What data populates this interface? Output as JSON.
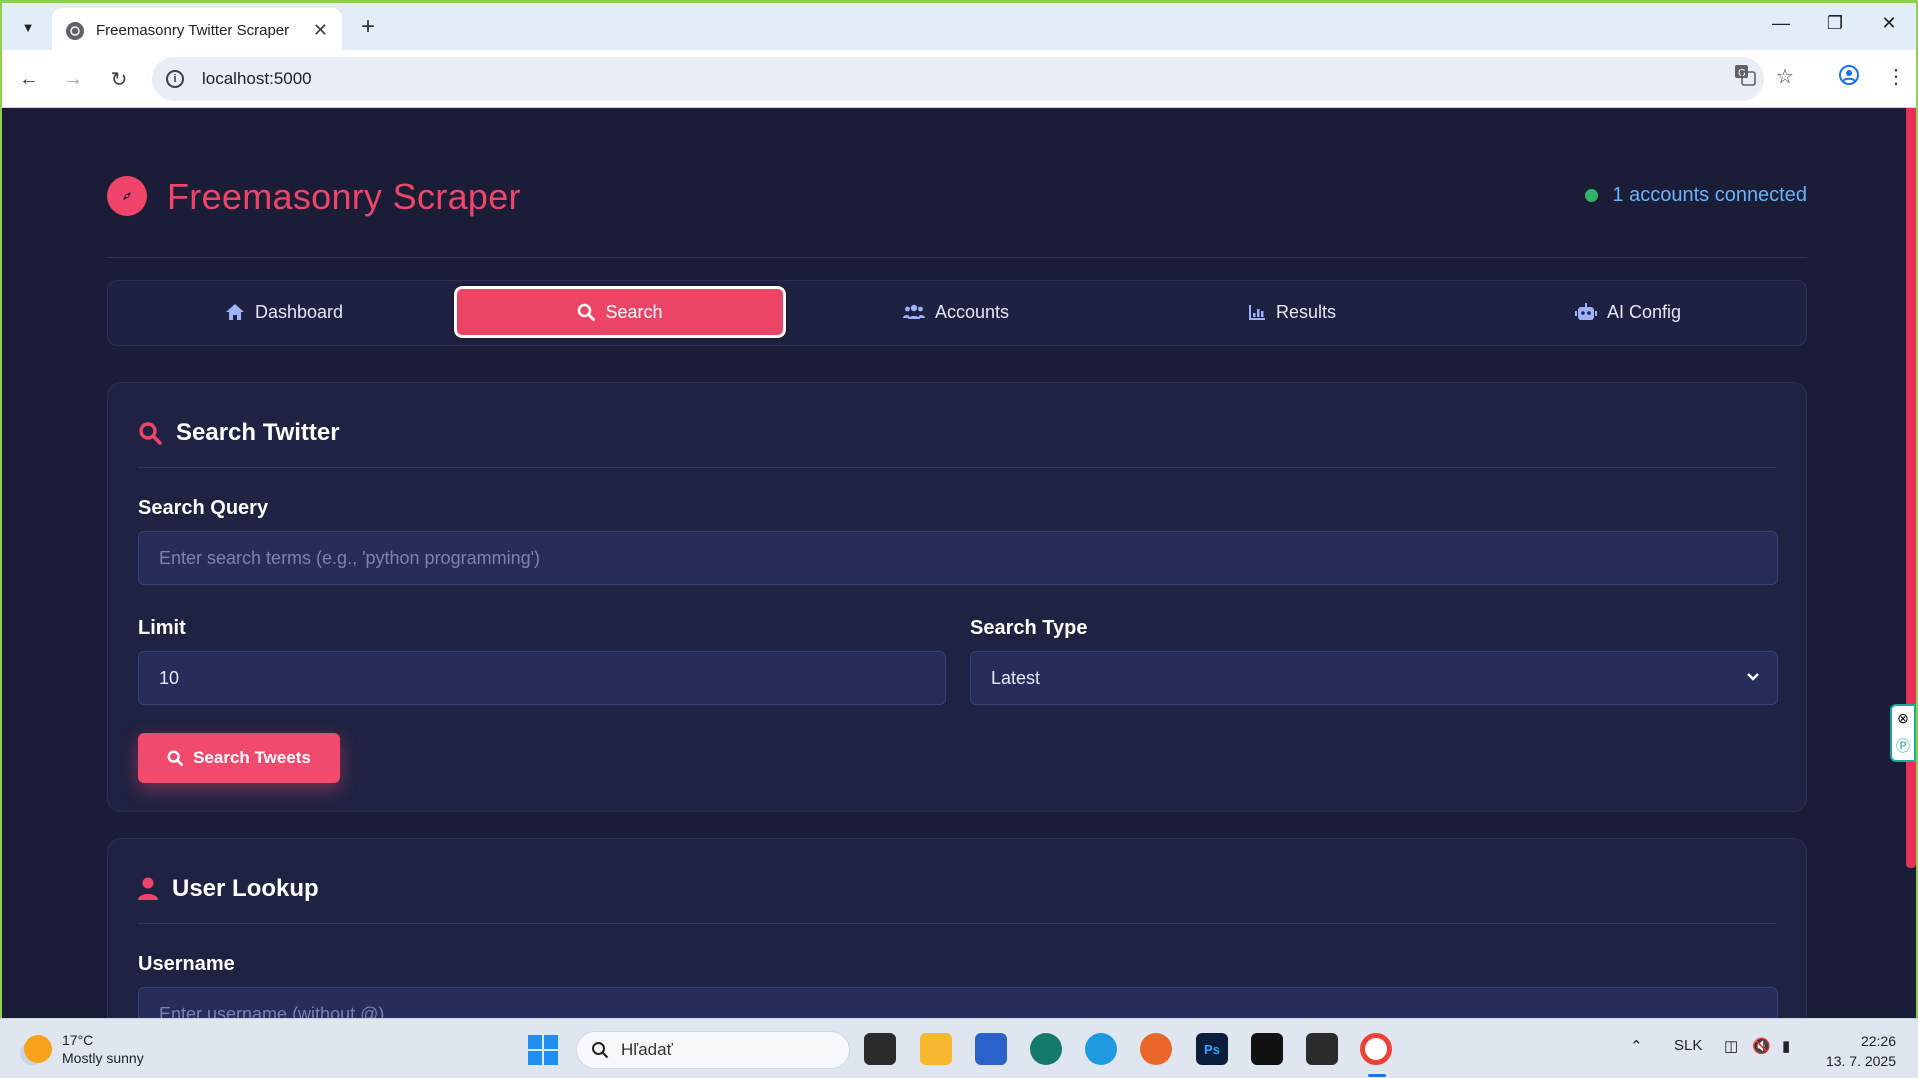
{
  "browser": {
    "tab_title": "Freemasonry Twitter Scraper",
    "url": "localhost:5000"
  },
  "app": {
    "title": "Freemasonry Scraper",
    "status": "1 accounts connected",
    "accent": "#f0446b",
    "status_color": "#2fb467"
  },
  "nav": {
    "tabs": [
      {
        "label": "Dashboard",
        "icon": "home-icon"
      },
      {
        "label": "Search",
        "icon": "search-icon",
        "active": true
      },
      {
        "label": "Accounts",
        "icon": "users-icon"
      },
      {
        "label": "Results",
        "icon": "chart-icon"
      },
      {
        "label": "AI Config",
        "icon": "robot-icon"
      }
    ]
  },
  "search_card": {
    "title": "Search Twitter",
    "query_label": "Search Query",
    "query_placeholder": "Enter search terms (e.g., 'python programming')",
    "limit_label": "Limit",
    "limit_value": "10",
    "type_label": "Search Type",
    "type_value": "Latest",
    "button": "Search Tweets"
  },
  "user_card": {
    "title": "User Lookup",
    "username_label": "Username",
    "username_placeholder": "Enter username (without @)"
  },
  "taskbar": {
    "temp": "17°C",
    "weather": "Mostly sunny",
    "search_placeholder": "Hľadať",
    "lang": "SLK",
    "time": "22:26",
    "date": "13. 7. 2025"
  }
}
